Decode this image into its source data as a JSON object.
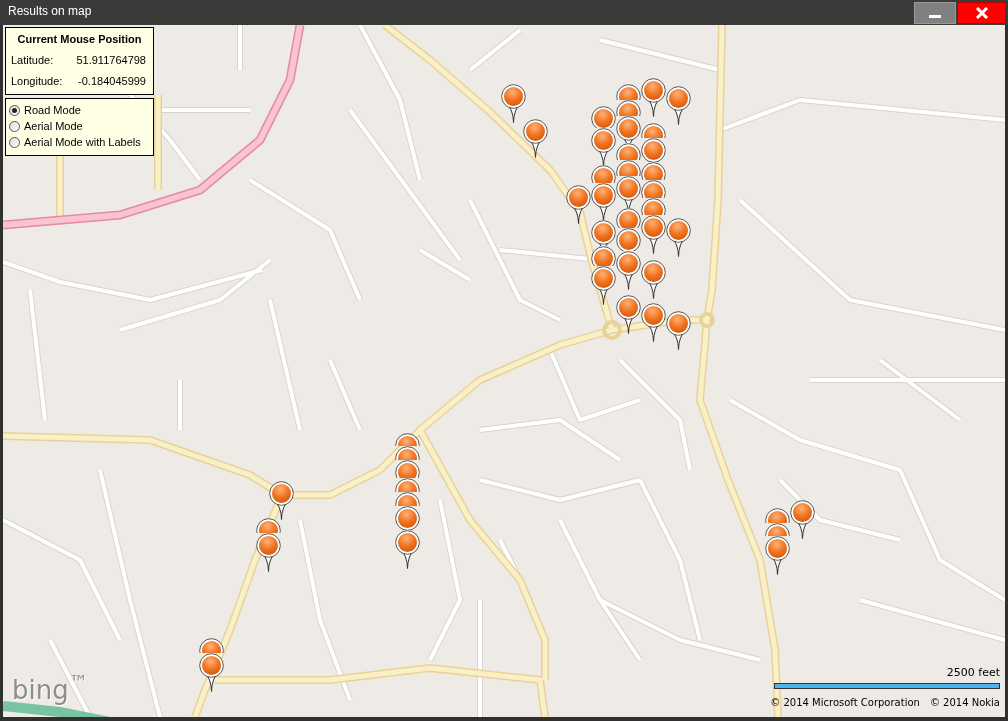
{
  "window": {
    "title": "Results on map",
    "controls": [
      {
        "kind": "minimize"
      },
      {
        "kind": "close"
      }
    ]
  },
  "mouse_position": {
    "title": "Current Mouse Position",
    "rows": [
      {
        "label": "Latitude:",
        "value": "51.911764798"
      },
      {
        "label": "Longitude:",
        "value": "-0.184045999"
      }
    ]
  },
  "map_modes": [
    {
      "label": "Road Mode",
      "selected": true
    },
    {
      "label": "Aerial Mode",
      "selected": false
    },
    {
      "label": "Aerial Mode with Labels",
      "selected": false
    }
  ],
  "map": {
    "logo": "bing$^{™}$",
    "scale": {
      "label": "2500 feet"
    },
    "copyrights": [
      "© 2014 Microsoft Corporation",
      "© 2014 Nokia"
    ]
  }
}
